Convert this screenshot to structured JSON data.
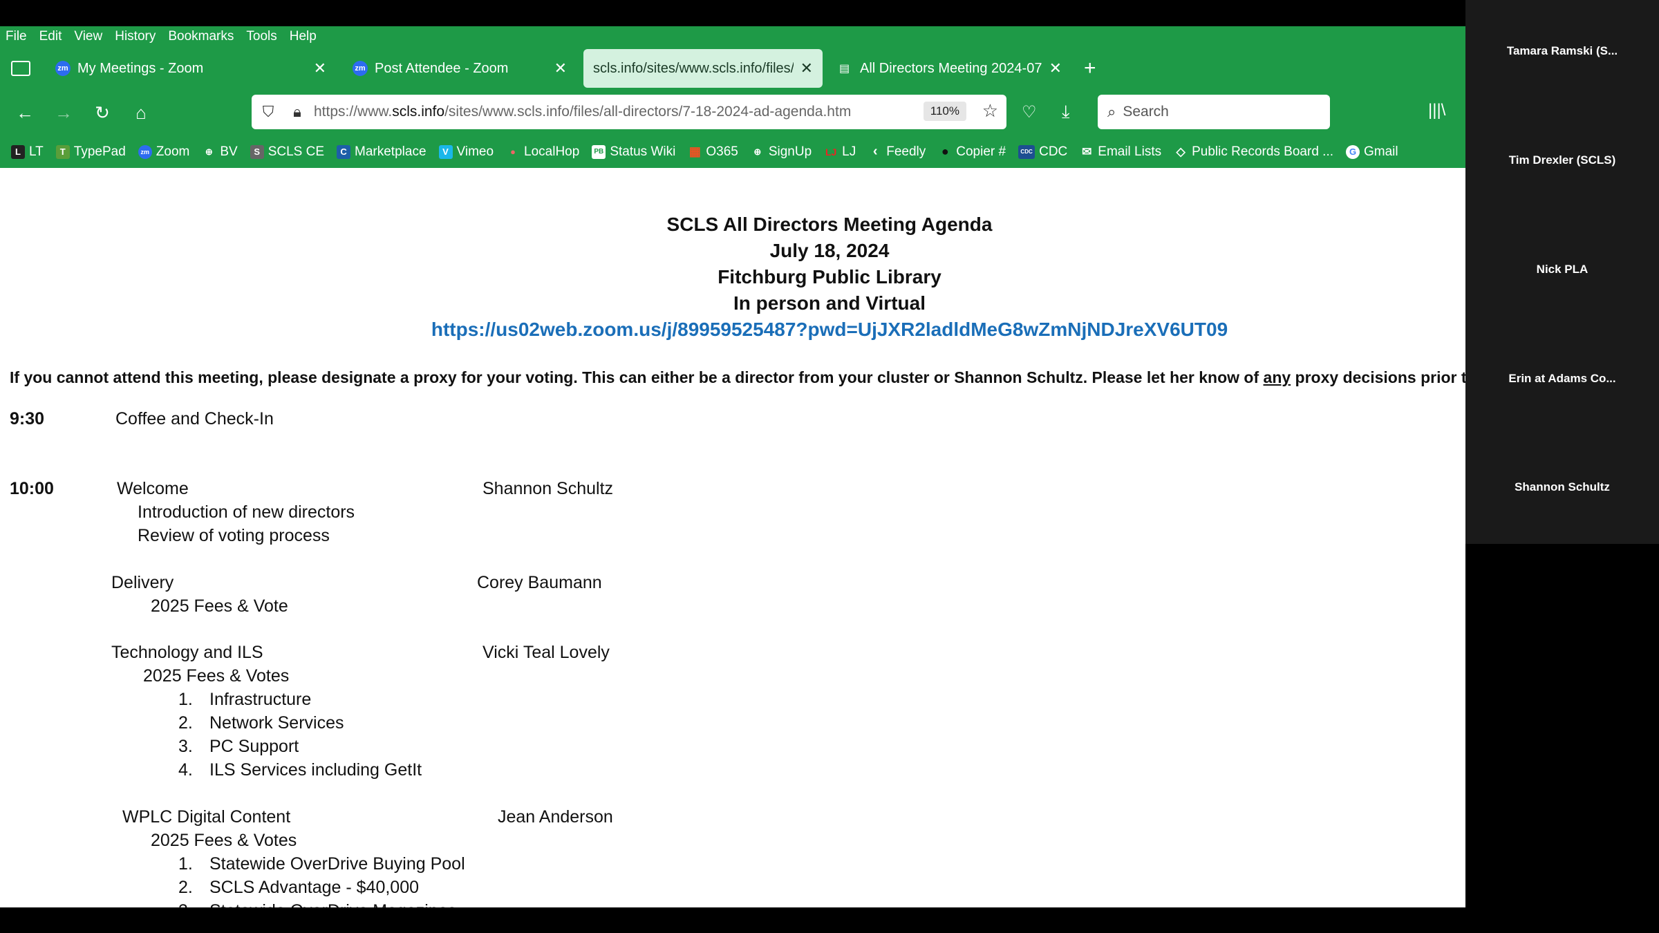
{
  "menu": [
    "File",
    "Edit",
    "View",
    "History",
    "Bookmarks",
    "Tools",
    "Help"
  ],
  "tabs": [
    {
      "label": "My Meetings - Zoom",
      "icon": "zm"
    },
    {
      "label": "Post Attendee - Zoom",
      "icon": "zm"
    },
    {
      "label": "scls.info/sites/www.scls.info/files/al"
    },
    {
      "label": "All Directors Meeting 2024-07"
    }
  ],
  "url": {
    "prefix": "https://www.",
    "domain": "scls.info",
    "path": "/sites/www.scls.info/files/all-directors/7-18-2024-ad-agenda.htm"
  },
  "zoom_level": "110%",
  "search_placeholder": "Search",
  "bookmarks": [
    {
      "label": "LT",
      "icon": "L"
    },
    {
      "label": "TypePad",
      "icon": "T"
    },
    {
      "label": "Zoom",
      "icon": "zm"
    },
    {
      "label": "BV",
      "icon": "⊕"
    },
    {
      "label": "SCLS CE",
      "icon": "S"
    },
    {
      "label": "Marketplace",
      "icon": "C"
    },
    {
      "label": "Vimeo",
      "icon": "V"
    },
    {
      "label": "LocalHop",
      "icon": "●"
    },
    {
      "label": "Status Wiki",
      "icon": "PB"
    },
    {
      "label": "O365",
      "icon": "▦"
    },
    {
      "label": "SignUp",
      "icon": "⊕"
    },
    {
      "label": "LJ",
      "icon": "LJ"
    },
    {
      "label": "Feedly",
      "icon": "‹"
    },
    {
      "label": "Copier #",
      "icon": "●"
    },
    {
      "label": "CDC",
      "icon": "CDC"
    },
    {
      "label": "Email Lists",
      "icon": "✉"
    },
    {
      "label": "Public Records Board ...",
      "icon": "◇"
    },
    {
      "label": "Gmail",
      "icon": "G"
    }
  ],
  "agenda": {
    "title": "SCLS All Directors Meeting Agenda",
    "date": "July 18, 2024",
    "location": "Fitchburg Public Library",
    "format": "In person and Virtual",
    "zoom_link": "https://us02web.zoom.us/j/89959525487?pwd=UjJXR2ladldMeG8wZmNjNDJreXV6UT09",
    "proxy_note_a": "If you cannot attend this meeting, please designate a proxy for your voting.  This can either be a director from your cluster or Shannon Schultz.  Please let her know of ",
    "proxy_note_any": "any",
    "proxy_note_b": " proxy decisions prior to the meet",
    "t1": "9:30",
    "coffee": "Coffee and Check-In",
    "t2": "10:00",
    "welcome": "Welcome",
    "welcome_presenter": "Shannon Schultz",
    "intro": "Introduction of new directors",
    "review": "Review of voting process",
    "delivery": "Delivery",
    "delivery_presenter": "Corey Baumann",
    "delivery_fees": "2025 Fees & Vote",
    "tech": "Technology and ILS",
    "tech_presenter": "Vicki Teal Lovely",
    "tech_fees": "2025 Fees & Votes",
    "tech_items": [
      "Infrastructure",
      "Network Services",
      "PC Support",
      "ILS Services including GetIt"
    ],
    "wplc": "WPLC Digital Content",
    "wplc_presenter": "Jean Anderson",
    "wplc_fees": "2025 Fees & Votes",
    "wplc_items": [
      "Statewide OverDrive Buying Pool",
      "SCLS Advantage - $40,000",
      "Statewide OverDrive Magazines"
    ],
    "nums": [
      "1.",
      "2.",
      "3.",
      "4."
    ]
  },
  "participants": [
    "Tamara Ramski (S...",
    "Tim Drexler (SCLS)",
    "Nick PLA",
    "Erin at Adams Co...",
    "Shannon Schultz"
  ],
  "colors": {
    "chrome": "#1e9a47",
    "link": "#1a6eb8",
    "panel": "#1a1a1a"
  }
}
